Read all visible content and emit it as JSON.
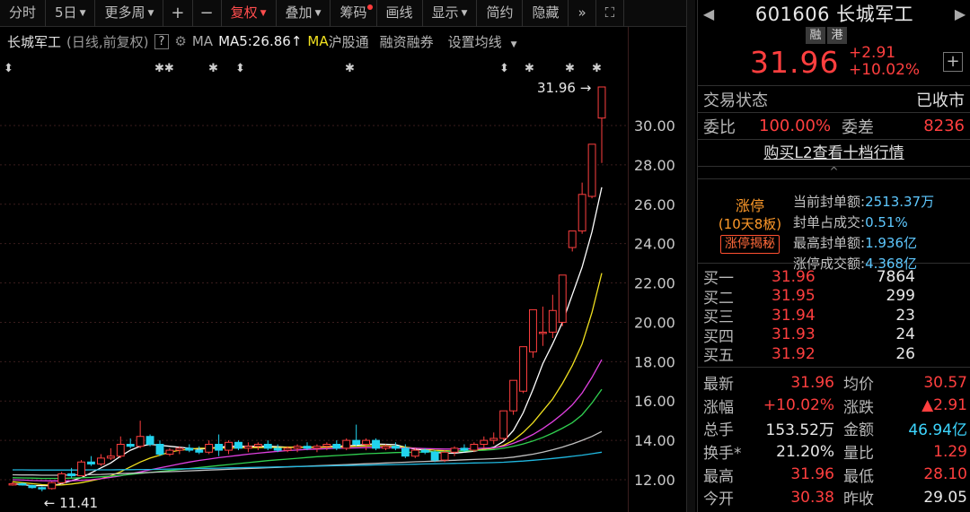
{
  "toolbar": {
    "items": [
      "分时",
      "5日",
      "更多周",
      "+",
      "−",
      "复权",
      "叠加",
      "筹码",
      "画线",
      "显示",
      "简约",
      "隐藏"
    ],
    "dropdowns": [
      false,
      true,
      true,
      false,
      false,
      true,
      true,
      false,
      false,
      true,
      false,
      false
    ],
    "active": "复权"
  },
  "info": {
    "name": "长城军工",
    "period": "(日线,前复权)",
    "help": "?",
    "ma_label": "MA",
    "ma5": "MA5:26.86",
    "ma5_arrow": "↑",
    "hgt_ma": "MA",
    "hgt": "沪股通",
    "rzrq": "融资融券",
    "set_ma": "设置均线"
  },
  "chart_data": {
    "type": "candlestick",
    "title": "",
    "ylim": [
      11.0,
      32.5
    ],
    "yticks": [
      "30.00",
      "28.00",
      "26.00",
      "24.00",
      "22.00",
      "20.00",
      "18.00",
      "16.00",
      "14.00",
      "12.00"
    ],
    "ytick_values": [
      30,
      28,
      26,
      24,
      22,
      20,
      18,
      16,
      14,
      12
    ],
    "high_label": "31.96",
    "low_label": "11.41",
    "candles": [
      [
        11.8,
        11.9,
        11.7,
        11.8
      ],
      [
        11.8,
        11.85,
        11.7,
        11.75
      ],
      [
        11.7,
        11.75,
        11.55,
        11.6
      ],
      [
        11.6,
        11.65,
        11.41,
        11.55
      ],
      [
        11.55,
        11.9,
        11.5,
        11.85
      ],
      [
        11.85,
        12.4,
        11.8,
        12.3
      ],
      [
        12.3,
        12.6,
        12.1,
        12.2
      ],
      [
        12.2,
        13.0,
        12.2,
        12.9
      ],
      [
        12.9,
        13.2,
        12.7,
        12.8
      ],
      [
        12.8,
        13.3,
        12.7,
        13.1
      ],
      [
        13.1,
        13.6,
        13.0,
        13.2
      ],
      [
        13.2,
        14.2,
        13.1,
        13.8
      ],
      [
        13.8,
        14.1,
        13.6,
        13.7
      ],
      [
        13.7,
        15.0,
        13.6,
        14.2
      ],
      [
        14.2,
        14.3,
        13.7,
        13.8
      ],
      [
        13.8,
        14.0,
        13.2,
        13.3
      ],
      [
        13.3,
        13.6,
        13.2,
        13.5
      ],
      [
        13.5,
        13.7,
        13.3,
        13.6
      ],
      [
        13.6,
        13.8,
        13.4,
        13.5
      ],
      [
        13.5,
        13.7,
        13.3,
        13.4
      ],
      [
        13.4,
        14.0,
        13.3,
        13.8
      ],
      [
        13.8,
        14.3,
        13.2,
        13.5
      ],
      [
        13.5,
        14.0,
        13.3,
        13.9
      ],
      [
        13.9,
        14.0,
        13.5,
        13.6
      ],
      [
        13.6,
        13.9,
        13.4,
        13.7
      ],
      [
        13.7,
        13.9,
        13.5,
        13.8
      ],
      [
        13.8,
        14.0,
        13.5,
        13.6
      ],
      [
        13.6,
        13.8,
        13.4,
        13.5
      ],
      [
        13.5,
        13.7,
        13.4,
        13.6
      ],
      [
        13.6,
        13.8,
        13.4,
        13.7
      ],
      [
        13.7,
        13.9,
        13.5,
        13.6
      ],
      [
        13.6,
        13.8,
        13.4,
        13.7
      ],
      [
        13.7,
        13.9,
        13.5,
        13.8
      ],
      [
        13.8,
        14.0,
        13.5,
        13.6
      ],
      [
        13.6,
        14.1,
        13.5,
        14.0
      ],
      [
        14.0,
        14.8,
        13.7,
        13.8
      ],
      [
        13.8,
        14.1,
        13.5,
        14.0
      ],
      [
        14.0,
        14.1,
        13.5,
        13.6
      ],
      [
        13.6,
        13.8,
        13.5,
        13.7
      ],
      [
        13.7,
        13.9,
        13.5,
        13.6
      ],
      [
        13.6,
        13.8,
        13.1,
        13.2
      ],
      [
        13.2,
        13.6,
        13.1,
        13.5
      ],
      [
        13.5,
        13.6,
        13.3,
        13.4
      ],
      [
        13.4,
        13.5,
        12.9,
        13.0
      ],
      [
        13.0,
        13.5,
        12.9,
        13.4
      ],
      [
        13.4,
        13.7,
        13.2,
        13.6
      ],
      [
        13.6,
        13.8,
        13.4,
        13.5
      ],
      [
        13.5,
        13.9,
        13.4,
        13.8
      ],
      [
        13.8,
        14.2,
        13.6,
        14.0
      ],
      [
        14.0,
        14.4,
        13.8,
        14.1
      ],
      [
        14.1,
        15.5,
        14.0,
        15.5
      ],
      [
        15.5,
        17.05,
        15.3,
        17.05
      ],
      [
        16.5,
        18.76,
        16.4,
        18.76
      ],
      [
        18.5,
        20.64,
        18.2,
        20.64
      ],
      [
        19.5,
        20.8,
        18.8,
        19.5
      ],
      [
        19.5,
        21.4,
        19.2,
        20.6
      ],
      [
        20.0,
        22.4,
        19.8,
        22.4
      ],
      [
        23.8,
        24.64,
        23.6,
        24.64
      ],
      [
        24.64,
        27.1,
        24.5,
        26.5
      ],
      [
        26.4,
        29.05,
        26.3,
        29.05
      ],
      [
        30.38,
        31.96,
        28.1,
        31.96
      ]
    ],
    "ma_series": [
      {
        "color": "#ffffff",
        "values": [
          11.8,
          11.75,
          11.7,
          11.7,
          11.7,
          11.8,
          11.95,
          12.1,
          12.35,
          12.6,
          12.85,
          13.2,
          13.5,
          13.7,
          13.8,
          13.75,
          13.7,
          13.65,
          13.6,
          13.55,
          13.6,
          13.65,
          13.7,
          13.7,
          13.7,
          13.7,
          13.7,
          13.68,
          13.65,
          13.65,
          13.65,
          13.65,
          13.68,
          13.7,
          13.72,
          13.75,
          13.8,
          13.82,
          13.8,
          13.78,
          13.65,
          13.55,
          13.5,
          13.4,
          13.35,
          13.35,
          13.4,
          13.45,
          13.55,
          13.65,
          13.95,
          14.5,
          15.4,
          16.6,
          17.9,
          18.9,
          20.0,
          21.4,
          22.8,
          24.6,
          26.86
        ]
      },
      {
        "color": "#f0e020",
        "values": [
          11.9,
          11.85,
          11.8,
          11.75,
          11.72,
          11.73,
          11.78,
          11.85,
          11.95,
          12.05,
          12.2,
          12.4,
          12.65,
          12.9,
          13.1,
          13.25,
          13.4,
          13.5,
          13.55,
          13.6,
          13.6,
          13.6,
          13.62,
          13.62,
          13.63,
          13.63,
          13.64,
          13.64,
          13.65,
          13.65,
          13.65,
          13.65,
          13.66,
          13.67,
          13.68,
          13.7,
          13.72,
          13.73,
          13.72,
          13.7,
          13.65,
          13.6,
          13.55,
          13.5,
          13.47,
          13.45,
          13.47,
          13.5,
          13.55,
          13.6,
          13.75,
          14.0,
          14.4,
          14.9,
          15.5,
          16.1,
          16.9,
          17.8,
          18.9,
          20.5,
          22.5
        ]
      },
      {
        "color": "#e040e0",
        "values": [
          12.0,
          11.98,
          11.96,
          11.95,
          11.94,
          11.94,
          11.95,
          11.97,
          12.0,
          12.05,
          12.12,
          12.2,
          12.3,
          12.4,
          12.5,
          12.6,
          12.7,
          12.8,
          12.9,
          12.98,
          13.05,
          13.12,
          13.18,
          13.24,
          13.3,
          13.35,
          13.4,
          13.44,
          13.48,
          13.51,
          13.54,
          13.56,
          13.58,
          13.6,
          13.61,
          13.62,
          13.63,
          13.63,
          13.63,
          13.62,
          13.61,
          13.6,
          13.58,
          13.57,
          13.56,
          13.56,
          13.57,
          13.58,
          13.6,
          13.62,
          13.7,
          13.85,
          14.05,
          14.3,
          14.6,
          14.95,
          15.35,
          15.8,
          16.4,
          17.2,
          18.1
        ]
      },
      {
        "color": "#30d050",
        "values": [
          12.1,
          12.09,
          12.08,
          12.07,
          12.07,
          12.07,
          12.08,
          12.1,
          12.12,
          12.15,
          12.18,
          12.22,
          12.27,
          12.32,
          12.37,
          12.42,
          12.47,
          12.52,
          12.57,
          12.62,
          12.67,
          12.72,
          12.77,
          12.82,
          12.87,
          12.92,
          12.97,
          13.01,
          13.05,
          13.09,
          13.13,
          13.17,
          13.2,
          13.23,
          13.26,
          13.29,
          13.32,
          13.34,
          13.36,
          13.38,
          13.39,
          13.4,
          13.41,
          13.42,
          13.43,
          13.44,
          13.46,
          13.48,
          13.5,
          13.53,
          13.6,
          13.7,
          13.82,
          13.97,
          14.15,
          14.37,
          14.62,
          14.9,
          15.3,
          15.9,
          16.6
        ]
      },
      {
        "color": "#c0c0c0",
        "values": [
          12.25,
          12.24,
          12.24,
          12.23,
          12.23,
          12.23,
          12.24,
          12.25,
          12.26,
          12.27,
          12.29,
          12.31,
          12.33,
          12.35,
          12.37,
          12.39,
          12.41,
          12.43,
          12.45,
          12.47,
          12.49,
          12.51,
          12.53,
          12.55,
          12.57,
          12.59,
          12.61,
          12.63,
          12.65,
          12.67,
          12.69,
          12.71,
          12.73,
          12.75,
          12.77,
          12.79,
          12.81,
          12.83,
          12.85,
          12.87,
          12.89,
          12.91,
          12.93,
          12.95,
          12.97,
          12.99,
          13.01,
          13.03,
          13.05,
          13.07,
          13.1,
          13.15,
          13.22,
          13.3,
          13.4,
          13.52,
          13.66,
          13.82,
          14.0,
          14.2,
          14.45
        ]
      },
      {
        "color": "#20b8e0",
        "values": [
          12.5,
          12.5,
          12.49,
          12.49,
          12.49,
          12.49,
          12.49,
          12.49,
          12.5,
          12.5,
          12.5,
          12.51,
          12.51,
          12.52,
          12.52,
          12.53,
          12.54,
          12.55,
          12.56,
          12.57,
          12.58,
          12.59,
          12.6,
          12.61,
          12.62,
          12.63,
          12.64,
          12.65,
          12.66,
          12.67,
          12.68,
          12.69,
          12.7,
          12.71,
          12.72,
          12.73,
          12.74,
          12.75,
          12.76,
          12.77,
          12.78,
          12.79,
          12.8,
          12.81,
          12.82,
          12.83,
          12.84,
          12.85,
          12.86,
          12.87,
          12.89,
          12.92,
          12.95,
          12.99,
          13.03,
          13.08,
          13.13,
          13.19,
          13.25,
          13.32,
          13.4
        ]
      }
    ]
  },
  "quote": {
    "code_name": "601606 长城军工",
    "badge1": "融",
    "badge2": "港",
    "price": "31.96",
    "change": "+2.91",
    "change_pct": "+10.02%",
    "status_label": "交易状态",
    "status_value": "已收市",
    "wb_label": "委比",
    "wb_value": "100.00%",
    "wc_label": "委差",
    "wc_value": "8236",
    "l2_link": "购买L2查看十档行情",
    "chevron": "^"
  },
  "limit_up": {
    "title": "涨停",
    "sub": "(10天8板)",
    "button": "涨停揭秘",
    "rows": [
      {
        "k": "当前封单额:",
        "v": "2513.37万"
      },
      {
        "k": "封单占成交:",
        "v": "0.51%"
      },
      {
        "k": "最高封单额:",
        "v": "1.936亿"
      },
      {
        "k": "涨停成交额:",
        "v": "4.368亿"
      }
    ]
  },
  "book": [
    {
      "n": "买一",
      "p": "31.96",
      "q": "7864"
    },
    {
      "n": "买二",
      "p": "31.95",
      "q": "299"
    },
    {
      "n": "买三",
      "p": "31.94",
      "q": "23"
    },
    {
      "n": "买四",
      "p": "31.93",
      "q": "24"
    },
    {
      "n": "买五",
      "p": "31.92",
      "q": "26"
    }
  ],
  "stats": [
    {
      "k1": "最新",
      "v1": "31.96",
      "c1": "red",
      "k2": "均价",
      "v2": "30.57",
      "c2": "red"
    },
    {
      "k1": "涨幅",
      "v1": "+10.02%",
      "c1": "red",
      "k2": "涨跌",
      "v2": "▲2.91",
      "c2": "red"
    },
    {
      "k1": "总手",
      "v1": "153.52万",
      "c1": "white",
      "k2": "金额",
      "v2": "46.94亿",
      "c2": "cyan"
    },
    {
      "k1": "换手*",
      "v1": "21.20%",
      "c1": "white",
      "k2": "量比",
      "v2": "1.29",
      "c2": "red"
    },
    {
      "k1": "最高",
      "v1": "31.96",
      "c1": "red",
      "k2": "最低",
      "v2": "28.10",
      "c2": "red"
    },
    {
      "k1": "今开",
      "v1": "30.38",
      "c1": "red",
      "k2": "昨收",
      "v2": "29.05",
      "c2": "white"
    }
  ],
  "colors": {
    "up": "#ff3f3f",
    "down": "#22d3ee",
    "bg": "#000000",
    "grid": "#3a1d1d"
  }
}
